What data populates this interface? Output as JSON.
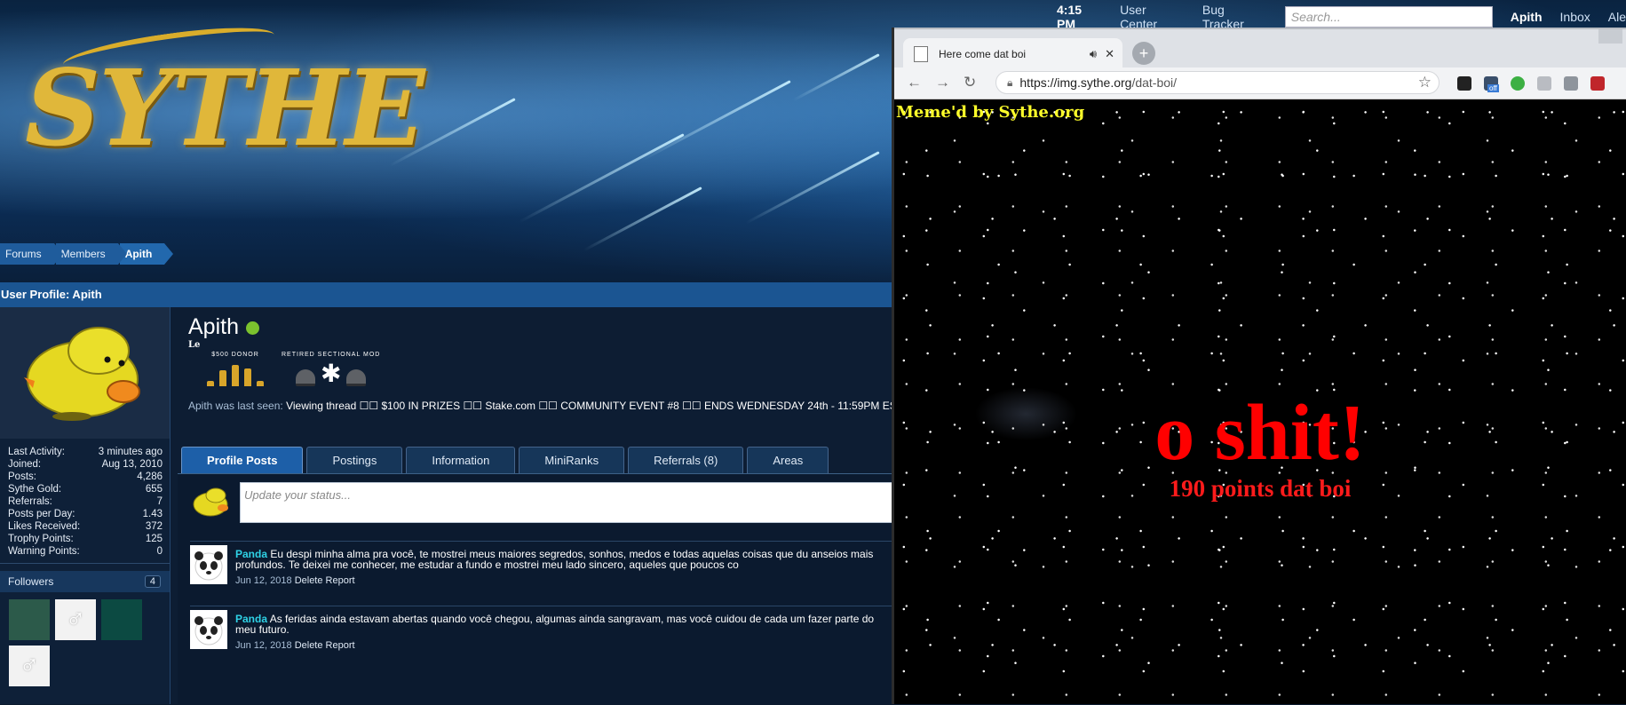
{
  "forum": {
    "logo_text": "SYTHE",
    "topnav": {
      "time": "4:15 PM",
      "user_center": "User Center",
      "bug_tracker": "Bug Tracker",
      "search_placeholder": "Search...",
      "username": "Apith",
      "inbox": "Inbox",
      "alerts": "Ale"
    },
    "breadcrumb": [
      "Forums",
      "Members",
      "Apith"
    ],
    "section_title": "User Profile: Apith",
    "profile": {
      "name": "Apith",
      "custom_title": "Le",
      "badges": [
        {
          "label": "$500 DONOR"
        },
        {
          "label": "RETIRED SECTIONAL MOD"
        }
      ],
      "last_seen_prefix": "Apith was last seen:",
      "last_seen_activity": "Viewing thread",
      "last_seen_thread": "☐☐ $100 IN PRIZES ☐☐ Stake.com ☐☐ COMMUNITY EVENT #8 ☐☐ ENDS WEDNESDAY 24th - 11:59PM ES",
      "stats": [
        {
          "label": "Last Activity:",
          "value": "3 minutes ago"
        },
        {
          "label": "Joined:",
          "value": "Aug 13, 2010"
        },
        {
          "label": "Posts:",
          "value": "4,286"
        },
        {
          "label": "Sythe Gold:",
          "value": "655"
        },
        {
          "label": "Referrals:",
          "value": "7"
        },
        {
          "label": "Posts per Day:",
          "value": "1.43"
        },
        {
          "label": "Likes Received:",
          "value": "372"
        },
        {
          "label": "Trophy Points:",
          "value": "125"
        },
        {
          "label": "Warning Points:",
          "value": "0"
        }
      ],
      "followers_label": "Followers",
      "followers_count": "4",
      "follower_symbols": [
        "",
        "♂",
        "",
        "♂"
      ]
    },
    "tabs": [
      {
        "label": "Profile Posts",
        "active": true
      },
      {
        "label": "Postings"
      },
      {
        "label": "Information"
      },
      {
        "label": "MiniRanks"
      },
      {
        "label": "Referrals (8)"
      },
      {
        "label": "Areas"
      }
    ],
    "status_placeholder": "Update your status...",
    "posts": [
      {
        "author": "Panda",
        "text": "Eu despi minha alma pra você, te mostrei meus maiores segredos, sonhos, medos e todas aquelas coisas que du anseios mais profundos. Te deixei me conhecer, me estudar a fundo e mostrei meu lado sincero, aqueles que poucos co",
        "date": "Jun 12, 2018",
        "actions": "Delete Report"
      },
      {
        "author": "Panda",
        "text": "As feridas ainda estavam abertas quando você chegou, algumas ainda sangravam, mas você cuidou de cada um fazer parte do meu futuro.",
        "date": "Jun 12, 2018",
        "actions": "Delete Report"
      }
    ]
  },
  "browser": {
    "tab_title": "Here come dat boi",
    "url_host": "https://img.sythe.org",
    "url_path": "/dat-boi/",
    "extension_badge": "off",
    "page_header": "Meme'd by Sythe.org",
    "headline": "o shit!",
    "subline": "190 points dat boi"
  },
  "icons": {
    "back": "back-arrow-icon",
    "forward": "forward-arrow-icon",
    "reload": "reload-icon",
    "lock": "lock-icon",
    "star": "bookmark-star-icon",
    "speaker": "speaker-icon",
    "close": "close-icon",
    "new_tab": "plus-icon"
  },
  "colors": {
    "forum_blue": "#1b5592",
    "online": "#7bc22e",
    "author": "#2fd2e6",
    "meme_yellow": "#ffff2a",
    "meme_red": "#ff0000"
  }
}
